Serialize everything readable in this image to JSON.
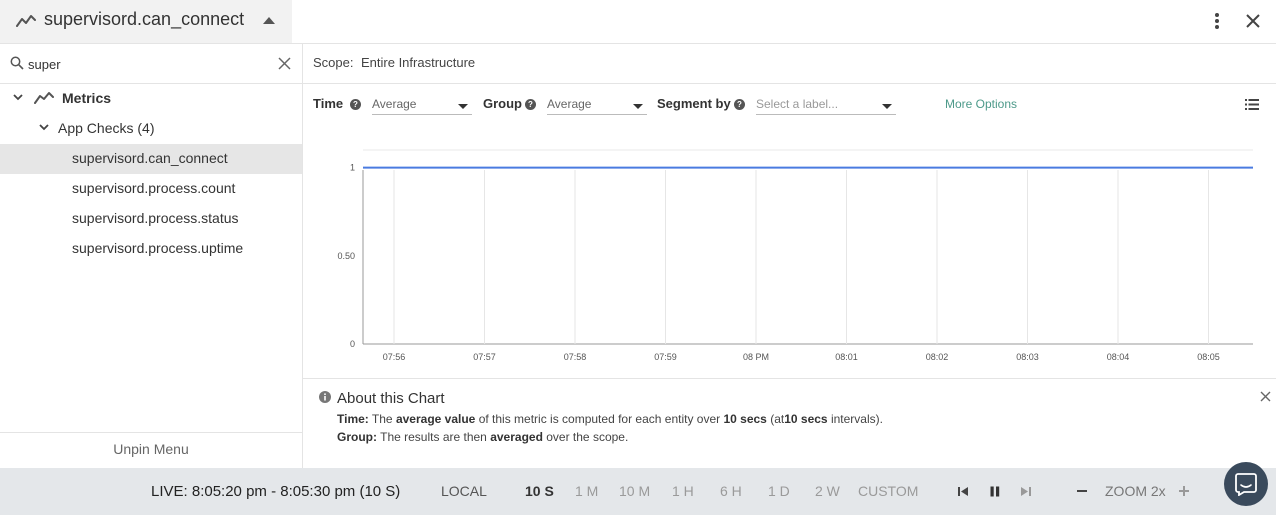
{
  "header": {
    "metric_title": "supervisord.can_connect"
  },
  "sidebar": {
    "search_value": "super",
    "tree": {
      "root_label": "Metrics",
      "group_label": "App Checks (4)",
      "items": [
        "supervisord.can_connect",
        "supervisord.process.count",
        "supervisord.process.status",
        "supervisord.process.uptime"
      ],
      "selected_index": 0
    },
    "unpin_label": "Unpin Menu"
  },
  "scope": {
    "label": "Scope:",
    "value": "Entire Infrastructure"
  },
  "controls": {
    "time_label": "Time",
    "time_value": "Average",
    "group_label": "Group",
    "group_value": "Average",
    "segment_label": "Segment by",
    "segment_placeholder": "Select a label...",
    "more_options": "More Options"
  },
  "chart_data": {
    "type": "line",
    "x": [
      "07:56",
      "07:57",
      "07:58",
      "07:59",
      "08 PM",
      "08:01",
      "08:02",
      "08:03",
      "08:04",
      "08:05"
    ],
    "series": [
      {
        "values": [
          1,
          1,
          1,
          1,
          1,
          1,
          1,
          1,
          1,
          1
        ],
        "color": "#4a7be0"
      }
    ],
    "yticks": [
      "0",
      "0.50",
      "1"
    ],
    "ylim": [
      0,
      1.1
    ],
    "grid": "vertical",
    "title": "",
    "xlabel": "",
    "ylabel": ""
  },
  "about": {
    "title": "About this Chart",
    "time_line": {
      "label": "Time:",
      "p1": "The",
      "b1": "average value",
      "p2": "of this metric is computed for each entity over",
      "b2": "10 secs",
      "p3": "(at",
      "b3": "10 secs",
      "p4": "intervals)."
    },
    "group_line": {
      "label": "Group:",
      "p1": "The results are then",
      "b1": "averaged",
      "p2": "over the scope."
    }
  },
  "bottombar": {
    "live_label": "LIVE: 8:05:20 pm - 8:05:30 pm (10 S)",
    "timezone": "LOCAL",
    "ranges": [
      "10 S",
      "1 M",
      "10 M",
      "1 H",
      "6 H",
      "1 D",
      "2 W",
      "CUSTOM"
    ],
    "active_range": "10 S",
    "zoom_label": "ZOOM 2x"
  },
  "icons": {
    "metric": "line-chart-icon",
    "collapse": "caret-up-icon",
    "more": "more-vertical-icon",
    "close": "close-icon",
    "search": "search-icon",
    "clear": "clear-icon",
    "info": "info-icon",
    "legend": "list-icon",
    "chat": "chat-icon"
  },
  "colors": {
    "series": "#4a7be0",
    "accent": "#4d9a8a",
    "selected_row": "#e6e6e6",
    "bottombar": "#e4e7ea"
  }
}
